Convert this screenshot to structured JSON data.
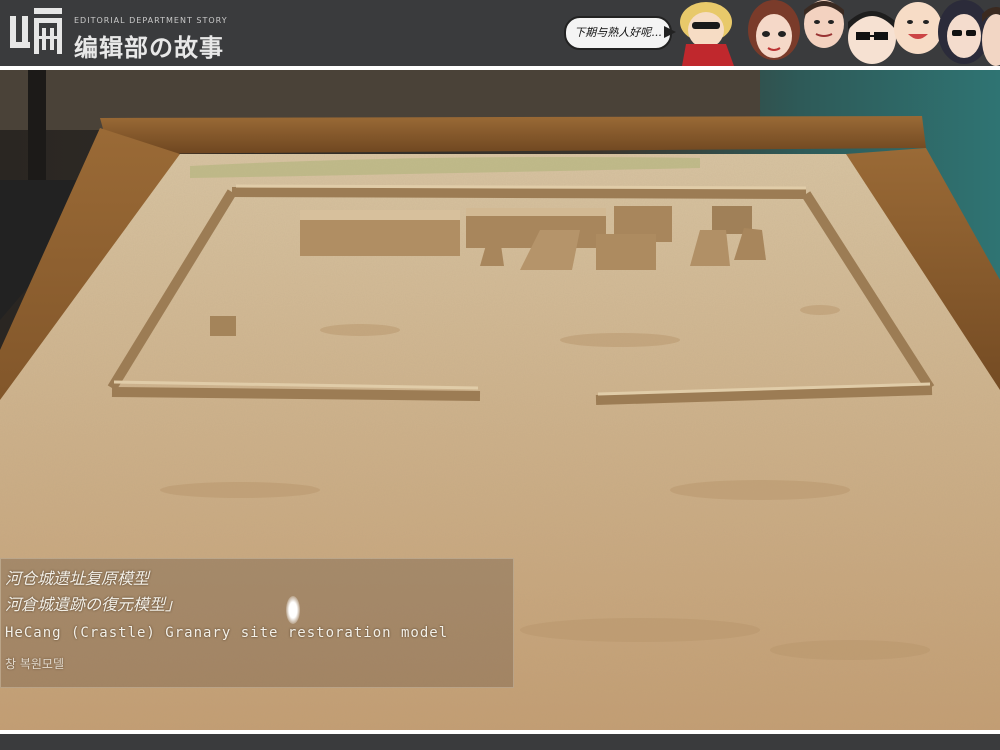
{
  "header": {
    "logo_sub": "EDITORIAL DEPARTMENT STORY",
    "logo_title": "编辑部の故事",
    "bubble_text": "下期与熟人好呢..."
  },
  "placard": {
    "line_chinese": "河仓城遗址复原模型",
    "line_japanese": "河倉城遺跡の復元模型」",
    "line_english": "HeCang  (Crastle) Granary site restoration model",
    "line_korean": "창 복원모델"
  },
  "colors": {
    "frame_bar": "#3a3b3d",
    "sand": "#cbb08a",
    "wood": "#8a5a2a",
    "teal_wall": "#2e6e6e"
  }
}
